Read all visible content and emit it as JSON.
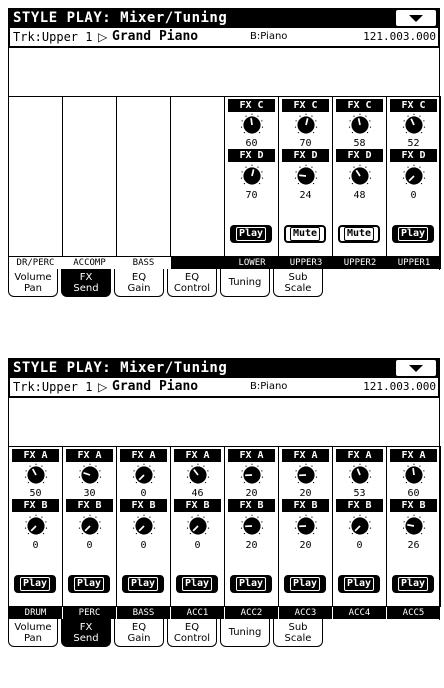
{
  "screens": [
    {
      "title": "STYLE PLAY: Mixer/Tuning",
      "track": {
        "label": "Trk:Upper 1",
        "arrow": "▷",
        "sound": "Grand Piano",
        "bank": "B:Piano",
        "program": "121.003.000"
      },
      "strips": [
        {
          "top_label": "",
          "top_value": "",
          "bot_label": "",
          "bot_value": "",
          "button": ""
        },
        {
          "top_label": "",
          "top_value": "",
          "bot_label": "",
          "bot_value": "",
          "button": ""
        },
        {
          "top_label": "",
          "top_value": "",
          "bot_label": "",
          "bot_value": "",
          "button": ""
        },
        {
          "top_label": "",
          "top_value": "",
          "bot_label": "",
          "bot_value": "",
          "button": ""
        },
        {
          "top_label": "FX C",
          "top_value": "60",
          "bot_label": "FX D",
          "bot_value": "70",
          "button": "Play"
        },
        {
          "top_label": "FX C",
          "top_value": "70",
          "bot_label": "FX D",
          "bot_value": "24",
          "button": "Mute"
        },
        {
          "top_label": "FX C",
          "top_value": "58",
          "bot_label": "FX D",
          "bot_value": "48",
          "button": "Mute"
        },
        {
          "top_label": "FX C",
          "top_value": "52",
          "bot_label": "FX D",
          "bot_value": "0",
          "button": "Play"
        }
      ],
      "names": [
        "DR/PERC",
        "ACCOMP",
        "BASS",
        "",
        "LOWER",
        "UPPER3",
        "UPPER2",
        "UPPER1"
      ],
      "tabs": [
        [
          "Volume",
          "Pan"
        ],
        [
          "FX",
          "Send"
        ],
        [
          "EQ",
          "Gain"
        ],
        [
          "EQ",
          "Control"
        ],
        [
          "Tuning",
          ""
        ],
        [
          "Sub",
          "Scale"
        ]
      ]
    },
    {
      "title": "STYLE PLAY: Mixer/Tuning",
      "track": {
        "label": "Trk:Upper 1",
        "arrow": "▷",
        "sound": "Grand Piano",
        "bank": "B:Piano",
        "program": "121.003.000"
      },
      "strips": [
        {
          "top_label": "FX A",
          "top_value": "50",
          "bot_label": "FX B",
          "bot_value": "0",
          "button": "Play"
        },
        {
          "top_label": "FX A",
          "top_value": "30",
          "bot_label": "FX B",
          "bot_value": "0",
          "button": "Play"
        },
        {
          "top_label": "FX A",
          "top_value": "0",
          "bot_label": "FX B",
          "bot_value": "0",
          "button": "Play"
        },
        {
          "top_label": "FX A",
          "top_value": "46",
          "bot_label": "FX B",
          "bot_value": "0",
          "button": "Play"
        },
        {
          "top_label": "FX A",
          "top_value": "20",
          "bot_label": "FX B",
          "bot_value": "20",
          "button": "Play"
        },
        {
          "top_label": "FX A",
          "top_value": "20",
          "bot_label": "FX B",
          "bot_value": "20",
          "button": "Play"
        },
        {
          "top_label": "FX A",
          "top_value": "53",
          "bot_label": "FX B",
          "bot_value": "0",
          "button": "Play"
        },
        {
          "top_label": "FX A",
          "top_value": "60",
          "bot_label": "FX B",
          "bot_value": "26",
          "button": "Play"
        }
      ],
      "names": [
        "DRUM",
        "PERC",
        "BASS",
        "ACC1",
        "ACC2",
        "ACC3",
        "ACC4",
        "ACC5"
      ],
      "tabs": [
        [
          "Volume",
          "Pan"
        ],
        [
          "FX",
          "Send"
        ],
        [
          "EQ",
          "Gain"
        ],
        [
          "EQ",
          "Control"
        ],
        [
          "Tuning",
          ""
        ],
        [
          "Sub",
          "Scale"
        ]
      ]
    }
  ],
  "active_tab_index": 1,
  "active_names_screen1": [
    3,
    4,
    5,
    6,
    7
  ]
}
